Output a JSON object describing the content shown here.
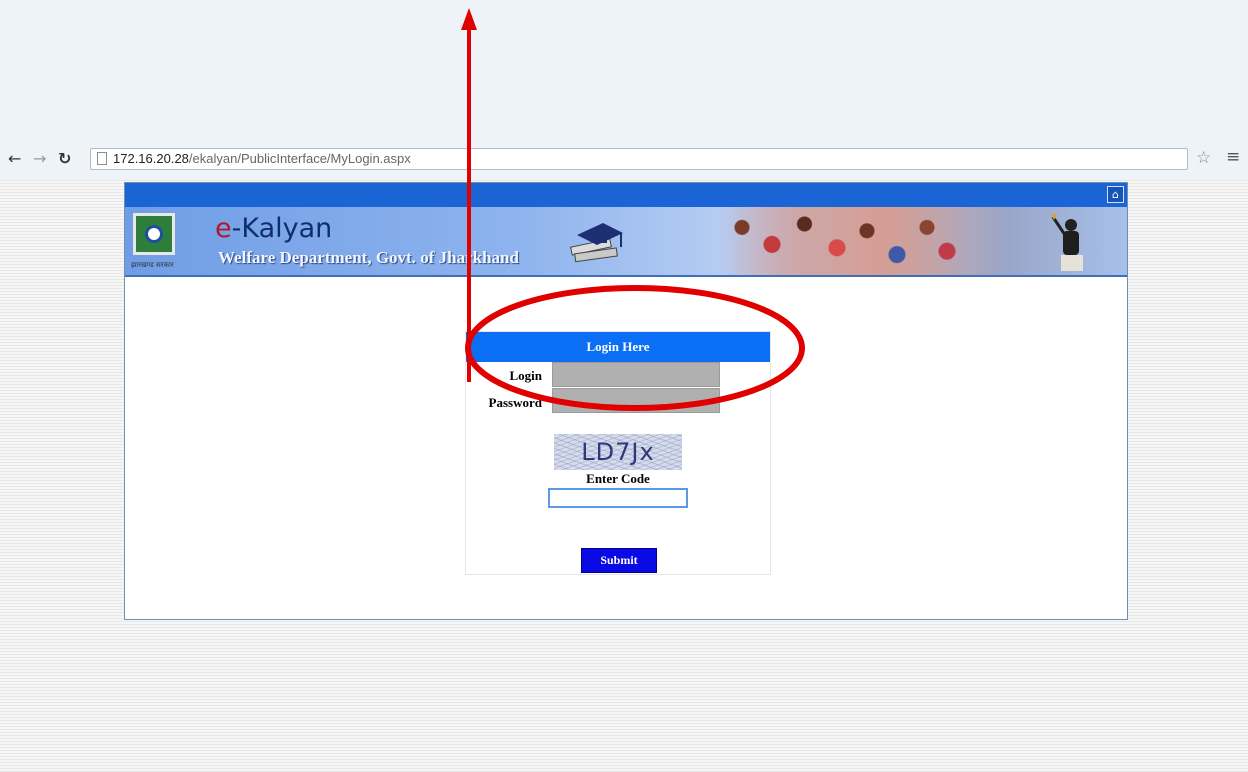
{
  "browser": {
    "url_host": "172.16.20.28",
    "url_path": "/ekalyan/PublicInterface/MyLogin.aspx",
    "icons": {
      "back": "back-arrow-icon",
      "forward": "forward-arrow-icon",
      "reload": "reload-icon",
      "bookmark": "star-icon",
      "menu": "menu-icon"
    }
  },
  "site": {
    "brand_e": "e",
    "brand_rest": "-Kalyan",
    "subtitle": "Welfare Department, Govt. of Jharkhand",
    "logo_caption": "झारखण्ड सरकार"
  },
  "login": {
    "header": "Login Here",
    "login_label": "Login",
    "password_label": "Password",
    "captcha_text": "LD7Jx",
    "enter_code_label": "Enter Code",
    "submit_label": "Submit"
  },
  "colors": {
    "top_bar": "#1b64d6",
    "login_header": "#0a6ff5",
    "submit": "#0a0ae6",
    "annotation": "#e00000"
  }
}
